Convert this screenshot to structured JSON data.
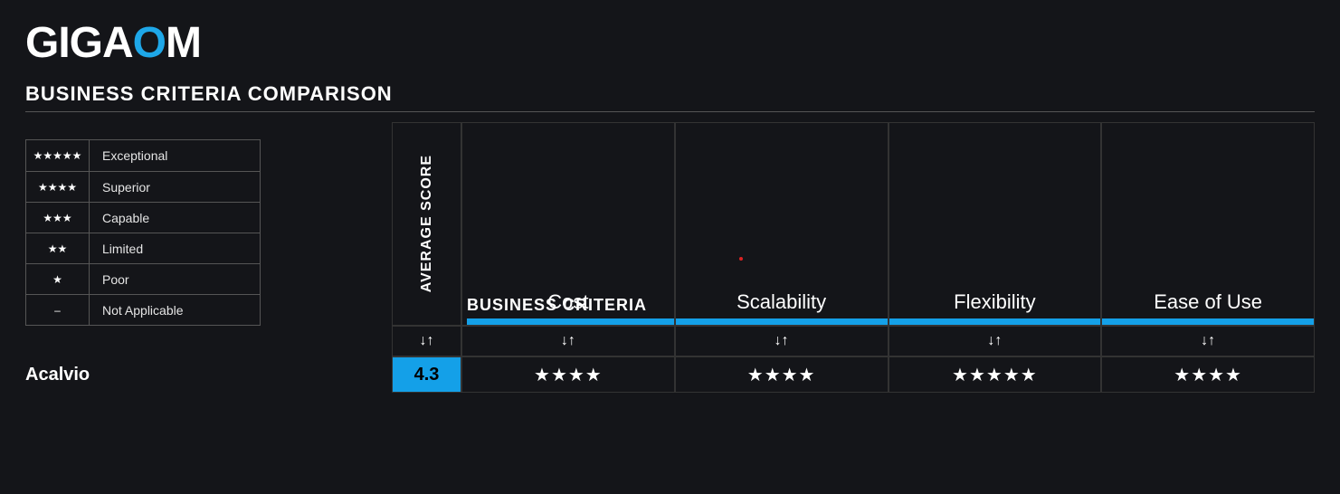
{
  "logo": {
    "part1": "GIGA",
    "part2": "O",
    "part3": "M"
  },
  "page_title": "BUSINESS CRITERIA COMPARISON",
  "legend": [
    {
      "stars": "★★★★★",
      "label": "Exceptional"
    },
    {
      "stars": "★★★★",
      "label": "Superior"
    },
    {
      "stars": "★★★",
      "label": "Capable"
    },
    {
      "stars": "★★",
      "label": "Limited"
    },
    {
      "stars": "★",
      "label": "Poor"
    },
    {
      "stars": "–",
      "label": "Not Applicable"
    }
  ],
  "avg_label": "AVERAGE SCORE",
  "group_header": "BUSINESS CRITERIA",
  "criteria": [
    "Cost",
    "Scalability",
    "Flexibility",
    "Ease of Use"
  ],
  "sort_icon": "↓↑",
  "rows": [
    {
      "vendor": "Acalvio",
      "score": "4.3",
      "ratings": [
        "★★★★",
        "★★★★",
        "★★★★★",
        "★★★★"
      ]
    }
  ]
}
